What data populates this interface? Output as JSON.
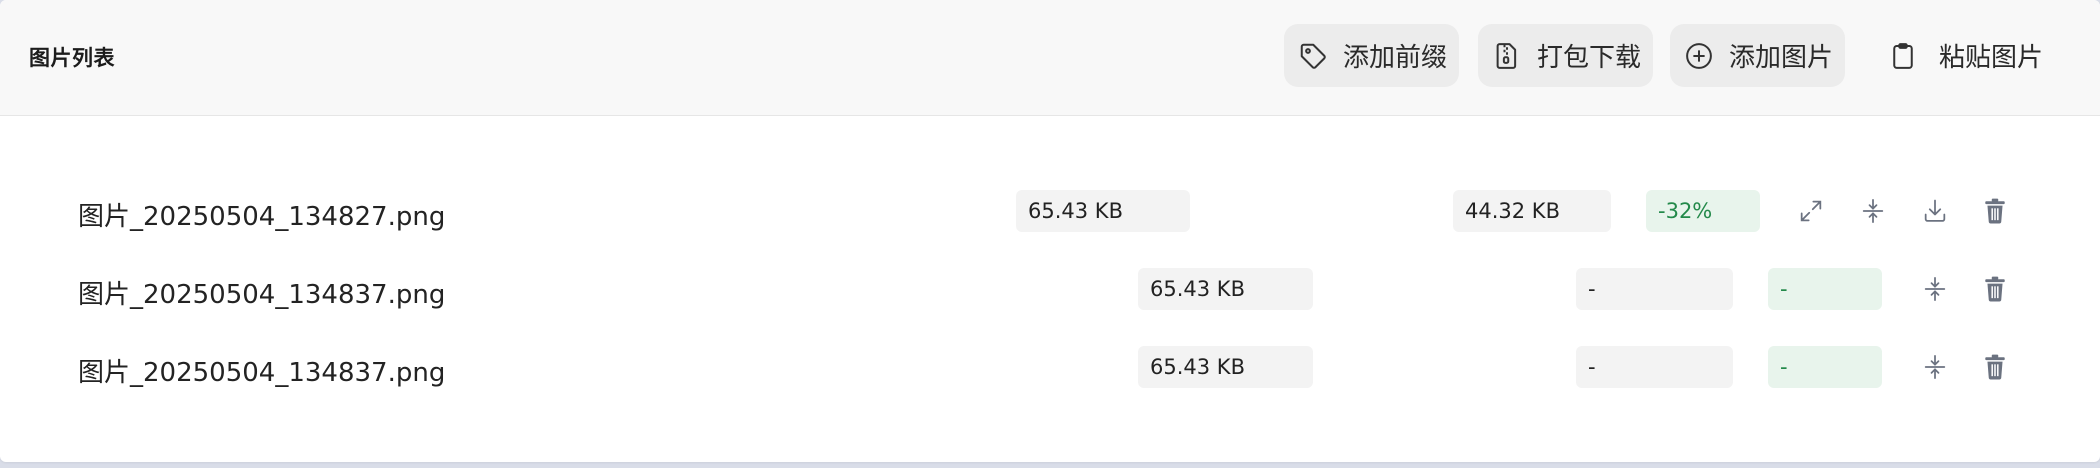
{
  "header": {
    "title": "图片列表",
    "buttons": {
      "add_prefix": "添加前缀",
      "pack_download": "打包下载",
      "add_image": "添加图片",
      "paste_image": "粘贴图片"
    }
  },
  "colors": {
    "success_text": "#23894a",
    "success_bg": "#e8f4ec",
    "button_bg": "#ececec",
    "icon_gray": "#6b7280"
  },
  "files": [
    {
      "name": "图片_20250504_134827.png",
      "original_size": "65.43 KB",
      "compressed_size": "44.32 KB",
      "ratio": "-32%",
      "actions": [
        "expand-icon",
        "compress-icon",
        "download-icon",
        "trash-icon"
      ]
    },
    {
      "name": "图片_20250504_134837.png",
      "original_size": "65.43 KB",
      "compressed_size": "-",
      "ratio": "-",
      "actions": [
        "compress-icon",
        "trash-icon"
      ]
    },
    {
      "name": "图片_20250504_134837.png",
      "original_size": "65.43 KB",
      "compressed_size": "-",
      "ratio": "-",
      "actions": [
        "compress-icon",
        "trash-icon"
      ]
    }
  ]
}
